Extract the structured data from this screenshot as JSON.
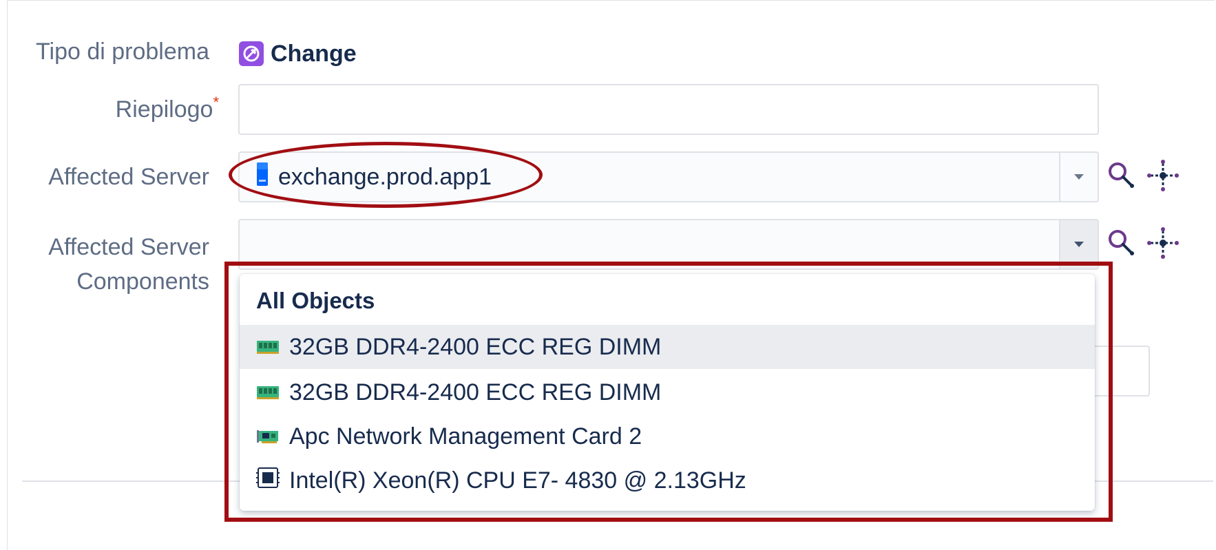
{
  "form": {
    "issue_type": {
      "label": "Tipo di problema",
      "value": "Change",
      "icon": "change-issue-type-icon"
    },
    "summary": {
      "label": "Riepilogo",
      "required_marker": "*",
      "value": ""
    },
    "affected_server": {
      "label": "Affected Server",
      "value": "exchange.prod.app1",
      "icon": "server-icon"
    },
    "affected_components": {
      "label_line1": "Affected Server",
      "label_line2": "Components",
      "value": ""
    }
  },
  "dropdown": {
    "group_header": "All Objects",
    "options": [
      {
        "label": "32GB DDR4-2400 ECC REG DIMM",
        "icon": "memory-module-icon"
      },
      {
        "label": "32GB DDR4-2400 ECC REG DIMM",
        "icon": "memory-module-icon"
      },
      {
        "label": "Apc Network Management Card 2",
        "icon": "network-card-icon"
      },
      {
        "label": "Intel(R) Xeon(R) CPU E7- 4830 @ 2.13GHz",
        "icon": "cpu-chip-icon"
      }
    ]
  },
  "colors": {
    "change_icon": "#904ee2",
    "annotation": "#a10e12",
    "tool_icon": "#6b3a8c"
  }
}
